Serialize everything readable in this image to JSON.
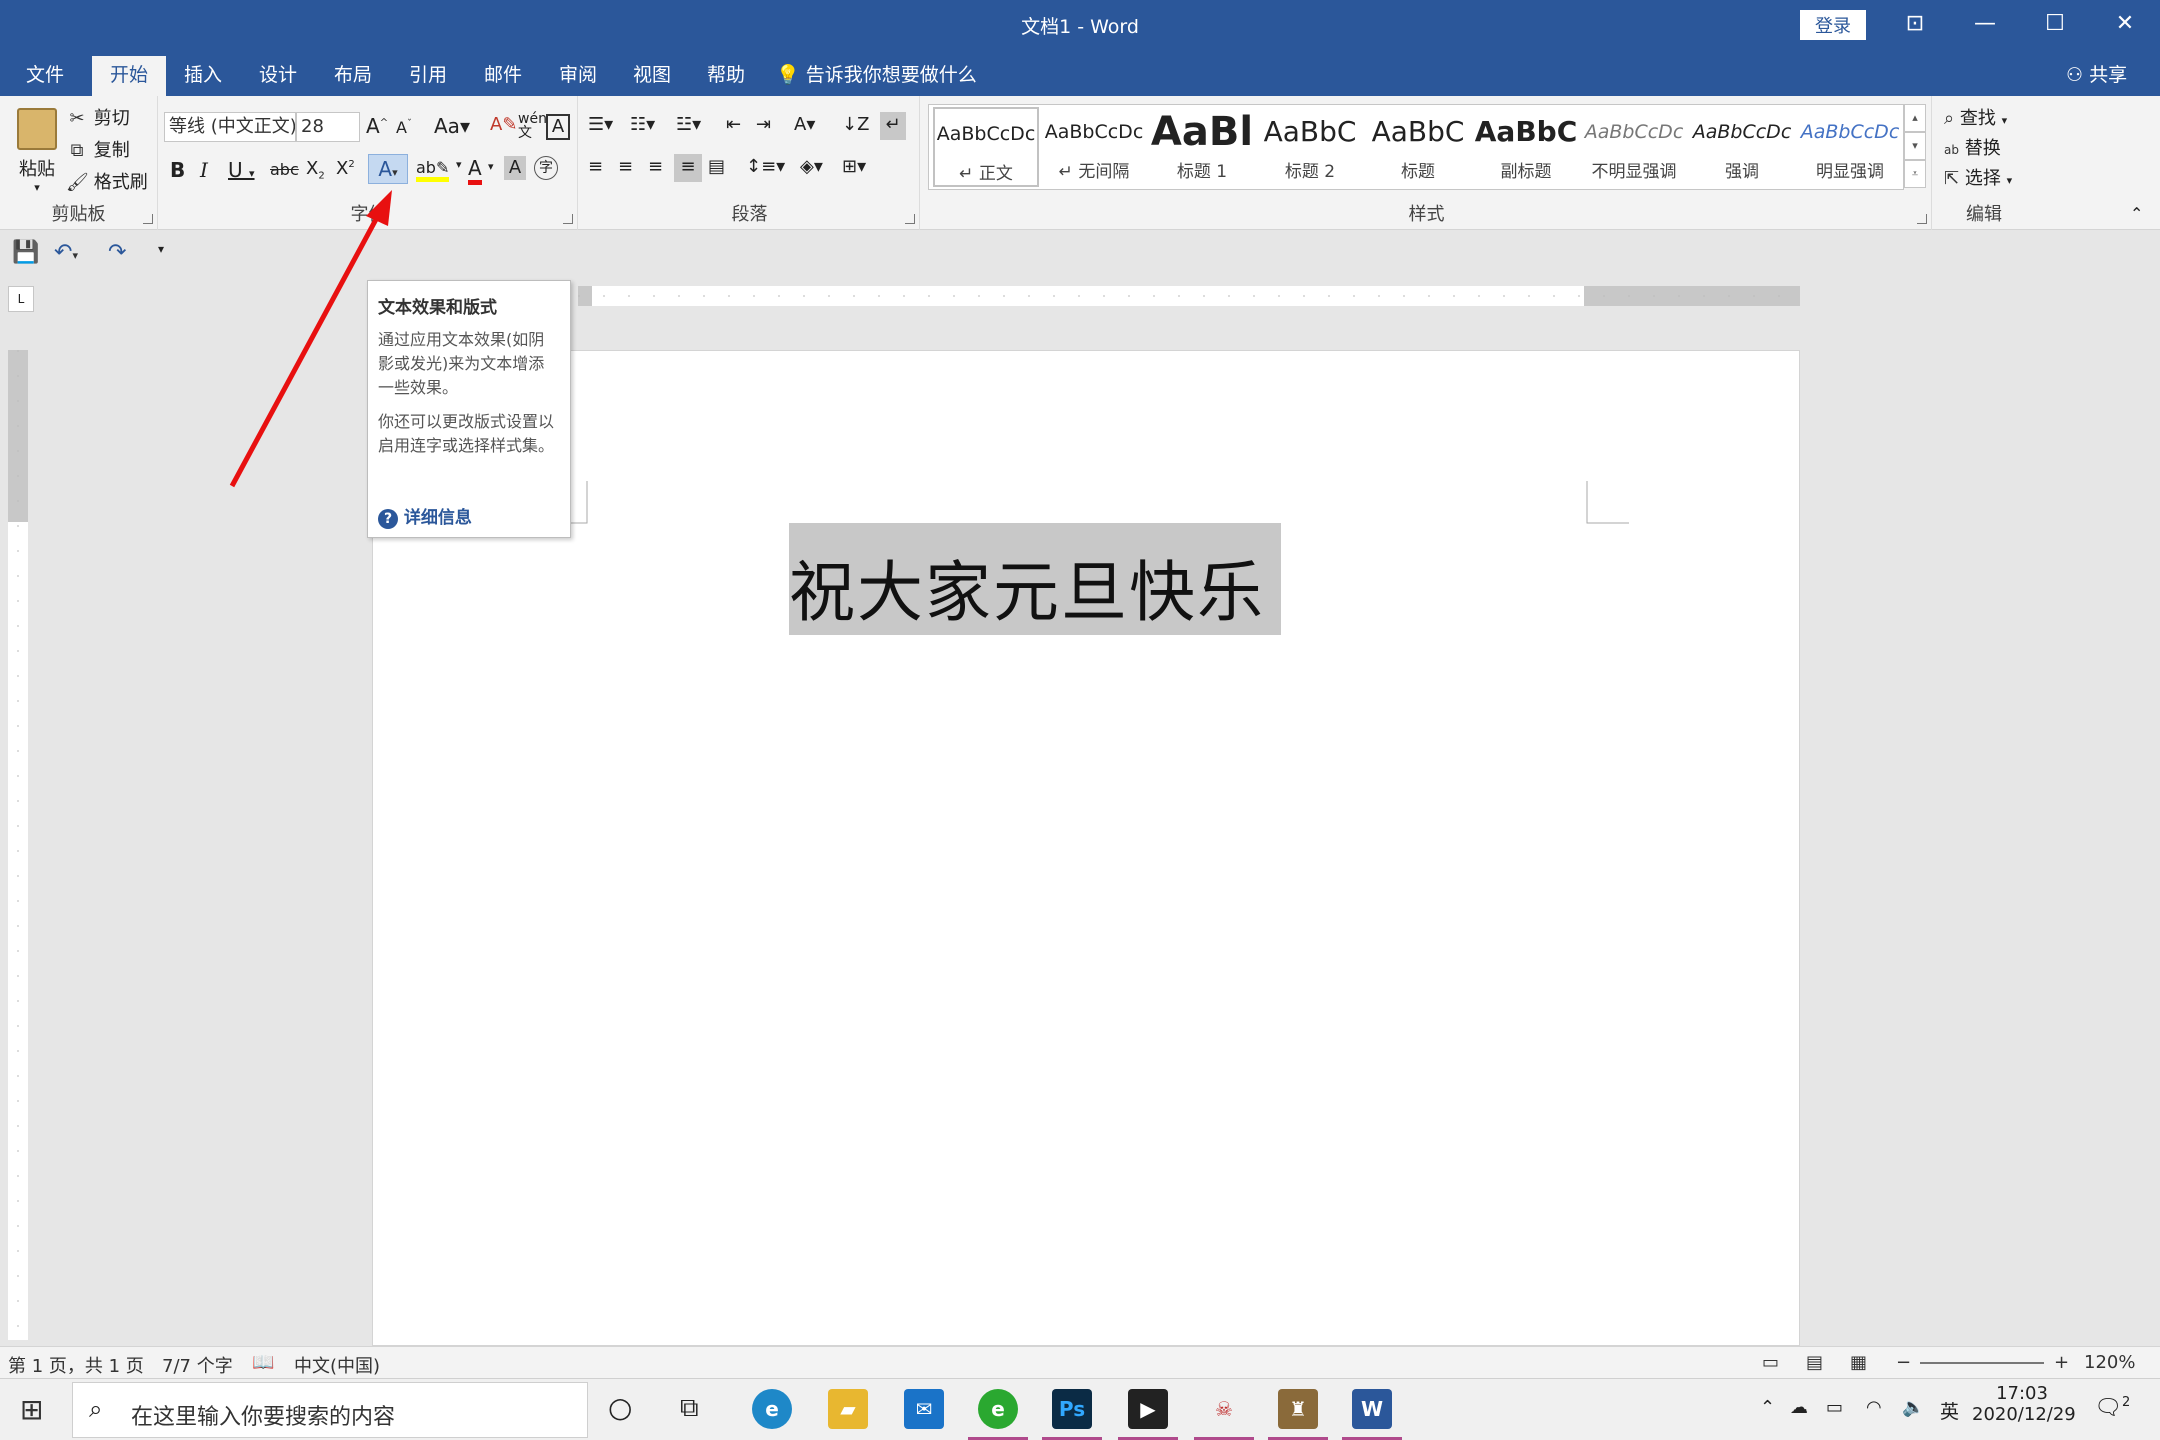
{
  "window": {
    "title": "文档1  -  Word",
    "login": "登录"
  },
  "tabs": [
    "文件",
    "开始",
    "插入",
    "设计",
    "布局",
    "引用",
    "邮件",
    "审阅",
    "视图",
    "帮助"
  ],
  "tell_me": "告诉我你想要做什么",
  "share": "共享",
  "clipboard": {
    "paste": "粘贴",
    "cut": "剪切",
    "copy": "复制",
    "format_painter": "格式刷",
    "label": "剪贴板"
  },
  "font": {
    "name": "等线 (中文正文)",
    "size": "28",
    "label": "字体"
  },
  "paragraph": {
    "label": "段落"
  },
  "styles": {
    "items": [
      {
        "sample": "AaBbCcDc",
        "name": "正文"
      },
      {
        "sample": "AaBbCcDc",
        "name": "无间隔"
      },
      {
        "sample": "AaBl",
        "name": "标题 1"
      },
      {
        "sample": "AaBbC",
        "name": "标题 2"
      },
      {
        "sample": "AaBbC",
        "name": "标题"
      },
      {
        "sample": "AaBbC",
        "name": "副标题"
      },
      {
        "sample": "AaBbCcDc",
        "name": "不明显强调"
      },
      {
        "sample": "AaBbCcDc",
        "name": "强调"
      },
      {
        "sample": "AaBbCcDc",
        "name": "明显强调"
      }
    ],
    "label": "样式"
  },
  "editing": {
    "find": "查找",
    "replace": "替换",
    "select": "选择",
    "label": "编辑"
  },
  "tooltip": {
    "title": "文本效果和版式",
    "body1": "通过应用文本效果(如阴影或发光)来为文本增添一些效果。",
    "body2": "你还可以更改版式设置以启用连字或选择样式集。",
    "link": "详细信息"
  },
  "document": {
    "text": "祝大家元旦快乐"
  },
  "status": {
    "page": "第 1 页，共 1 页",
    "words": "7/7 个字",
    "lang": "中文(中国)",
    "zoom": "120%"
  },
  "taskbar": {
    "search_placeholder": "在这里输入你要搜索的内容",
    "ime": "英",
    "time": "17:03",
    "date": "2020/12/29",
    "notif": "2"
  },
  "colors": {
    "accent": "#2b579a",
    "arrow": "#e81010"
  }
}
